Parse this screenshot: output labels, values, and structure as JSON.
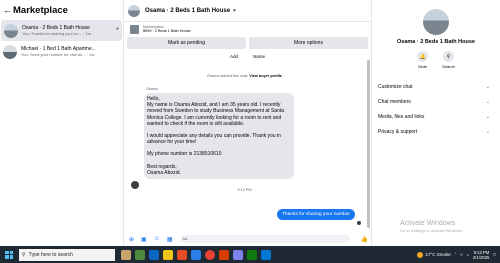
{
  "sidebar": {
    "back_icon": "arrow-left-icon",
    "title": "Marketplace",
    "conversations": [
      {
        "name": "Osama · 2 Beds 1 Bath House",
        "snippet": "You: Thanks for sharing your nu... · 1m",
        "active": true
      },
      {
        "name": "Michael · 1 Bed 1 Bath Apartme...",
        "snippet": "You: Send your number for visit an... · 1w",
        "active": false
      }
    ]
  },
  "chat": {
    "title": "Osama · 2 Beds 1 Bath House",
    "listing": {
      "label": "Marketplace",
      "price_title": "$999 · 2 Beds 1 Bath House"
    },
    "buttons": {
      "mark_pending": "Mark as pending",
      "more_options": "More options"
    },
    "top_row": {
      "add": "Add",
      "name": "Name"
    },
    "system_message": {
      "prefix": "Osama started this chat.",
      "link": "View buyer profile"
    },
    "sender_label": "Osama",
    "incoming_paragraphs": [
      "Hello,\nMy name is Osama Abozid, and I am 35 years old. I recently moved from Sweden to study Business Management at Santa Monica College. I am currently looking for a room to rent and wanted to check if the room is still available.",
      "I would appreciate any details you can provide. Thank you in advance for your time!",
      "My phone number is 2138510610",
      "Best regards,\nOsama Abozid."
    ],
    "timestamp": "9:12 PM",
    "outgoing_message": "Thanks for sharing your number",
    "composer_placeholder": "Aa"
  },
  "right_panel": {
    "title": "Osama · 2 Beds 1 Bath House",
    "actions": [
      {
        "label": "Mute",
        "icon": "bell-icon"
      },
      {
        "label": "Search",
        "icon": "search-icon"
      }
    ],
    "sections": [
      "Customize chat",
      "Chat members",
      "Media, files and links",
      "Privacy & support"
    ],
    "watermark_title": "Activate Windows",
    "watermark_sub": "Go to Settings to activate Windows."
  },
  "taskbar": {
    "search_placeholder": "Type here to search",
    "weather": "17°C  Smoke",
    "time": "9:13 PM",
    "date": "2/1/2025"
  },
  "colors": {
    "accent": "#1877f2",
    "bubble_in": "#e4e6eb",
    "taskbar": "#1f2933"
  }
}
